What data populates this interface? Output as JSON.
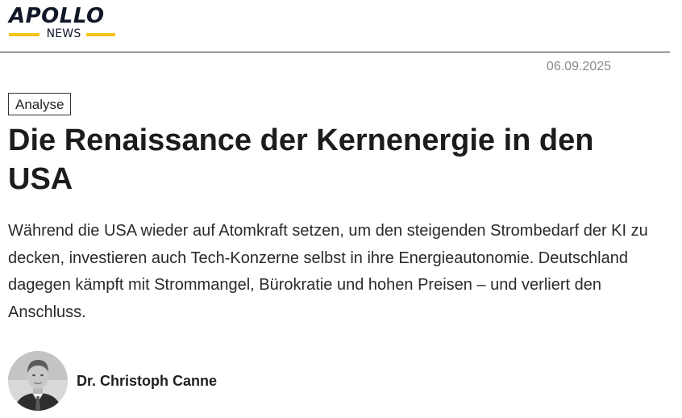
{
  "header": {
    "logo_main": "APOLLO",
    "logo_sub": "NEWS"
  },
  "article": {
    "date": "06.09.2025",
    "category": "Analyse",
    "title": "Die Renaissance der Kernenergie in den USA",
    "lead": "Während die USA wieder auf Atomkraft setzen, um den steigenden Strombedarf der KI zu decken, investieren auch Tech-Konzerne selbst in ihre Energieautonomie. Deutschland dagegen kämpft mit Strommangel, Bürokratie und hohen Preisen – und verliert den Anschluss.",
    "author": {
      "name": "Dr. Christoph Canne",
      "avatar_icon": "author-portrait"
    }
  },
  "colors": {
    "brand_dark": "#101828",
    "brand_accent": "#f5c518",
    "text": "#1f1f1f",
    "muted": "#8a8a8a"
  }
}
